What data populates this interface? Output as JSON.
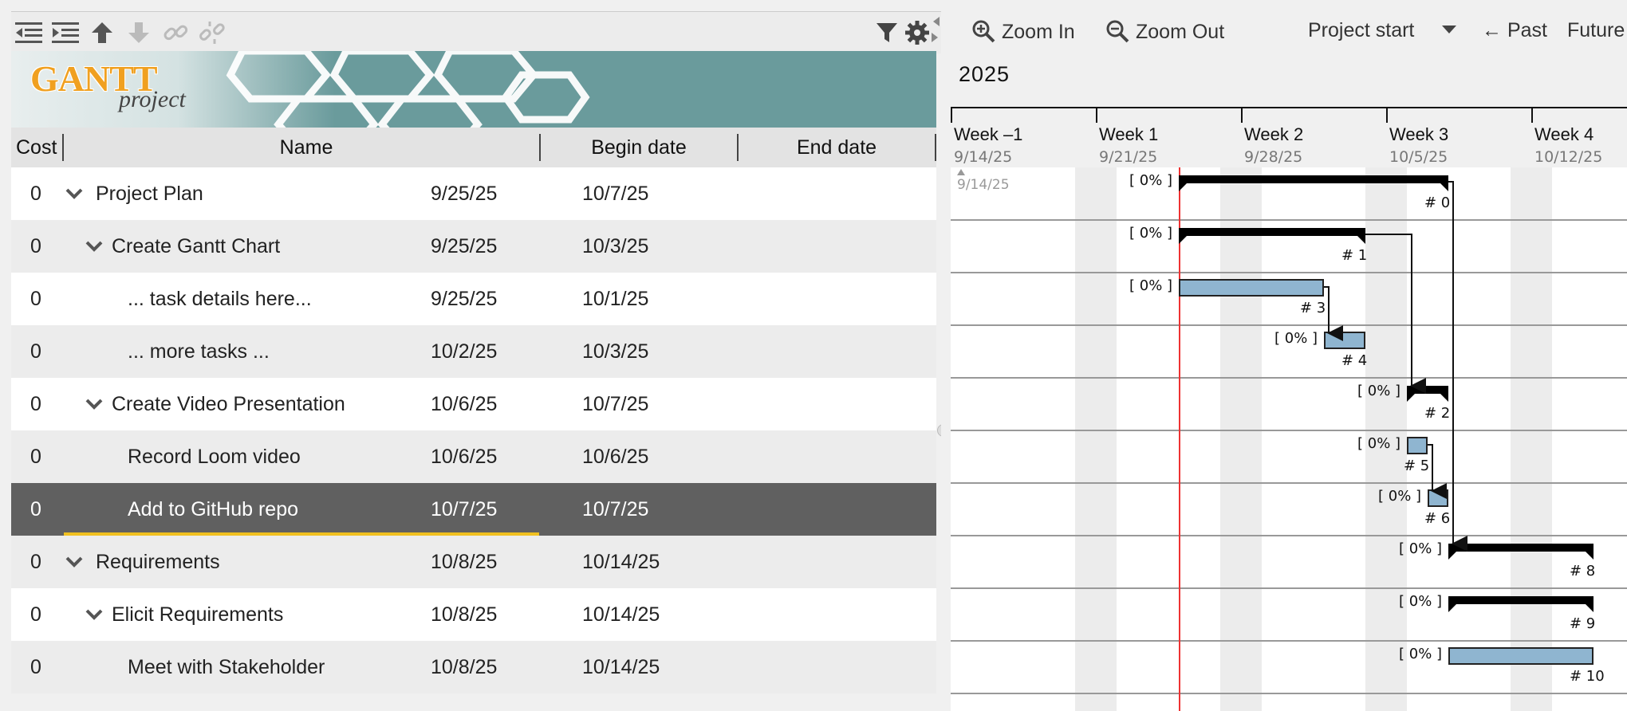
{
  "toolbar": {
    "icons": [
      "outdent-icon",
      "indent-icon",
      "move-up-icon",
      "move-down-icon",
      "link-icon",
      "unlink-icon",
      "filter-icon",
      "gear-icon"
    ]
  },
  "banner": {
    "logo_main": "GANTT",
    "logo_sub": "project"
  },
  "columns": {
    "cost": "Cost",
    "name": "Name",
    "begin": "Begin date",
    "end": "End date"
  },
  "tasks": [
    {
      "cost": "0",
      "name": "Project Plan",
      "begin": "9/25/25",
      "end": "10/7/25",
      "level": 0,
      "expandable": true
    },
    {
      "cost": "0",
      "name": "Create Gantt Chart",
      "begin": "9/25/25",
      "end": "10/3/25",
      "level": 1,
      "expandable": true
    },
    {
      "cost": "0",
      "name": "... task details here...",
      "begin": "9/25/25",
      "end": "10/1/25",
      "level": 2,
      "expandable": false
    },
    {
      "cost": "0",
      "name": "... more tasks ...",
      "begin": "10/2/25",
      "end": "10/3/25",
      "level": 2,
      "expandable": false
    },
    {
      "cost": "0",
      "name": "Create Video Presentation",
      "begin": "10/6/25",
      "end": "10/7/25",
      "level": 1,
      "expandable": true
    },
    {
      "cost": "0",
      "name": "Record Loom video",
      "begin": "10/6/25",
      "end": "10/6/25",
      "level": 2,
      "expandable": false
    },
    {
      "cost": "0",
      "name": "Add to GitHub repo",
      "begin": "10/7/25",
      "end": "10/7/25",
      "level": 2,
      "expandable": false,
      "selected": true
    },
    {
      "cost": "0",
      "name": "Requirements",
      "begin": "10/8/25",
      "end": "10/14/25",
      "level": 0,
      "expandable": true
    },
    {
      "cost": "0",
      "name": "Elicit Requirements",
      "begin": "10/8/25",
      "end": "10/14/25",
      "level": 1,
      "expandable": true
    },
    {
      "cost": "0",
      "name": "Meet with Stakeholder",
      "begin": "10/8/25",
      "end": "10/14/25",
      "level": 2,
      "expandable": false
    }
  ],
  "chart_toolbar": {
    "zoom_in": "Zoom In",
    "zoom_out": "Zoom Out",
    "project_start": "Project start",
    "past": "← Past",
    "future": "Future"
  },
  "chart": {
    "year": "2025",
    "weeks": [
      {
        "name": "Week –1",
        "date": "9/14/25"
      },
      {
        "name": "Week 1",
        "date": "9/21/25"
      },
      {
        "name": "Week 2",
        "date": "9/28/25"
      },
      {
        "name": "Week 3",
        "date": "10/5/25"
      },
      {
        "name": "Week 4",
        "date": "10/12/25"
      }
    ],
    "project_start_marker": "9/14/25",
    "today": "9/25/25",
    "bars": [
      {
        "id": "# 0",
        "progress": "[ 0% ]",
        "type": "summary"
      },
      {
        "id": "# 1",
        "progress": "[ 0% ]",
        "type": "summary"
      },
      {
        "id": "# 3",
        "progress": "[ 0% ]",
        "type": "task"
      },
      {
        "id": "# 4",
        "progress": "[ 0% ]",
        "type": "task"
      },
      {
        "id": "# 2",
        "progress": "[ 0% ]",
        "type": "summary"
      },
      {
        "id": "# 5",
        "progress": "[ 0% ]",
        "type": "task"
      },
      {
        "id": "# 6",
        "progress": "[ 0% ]",
        "type": "task"
      },
      {
        "id": "# 8",
        "progress": "[ 0% ]",
        "type": "summary"
      },
      {
        "id": "# 9",
        "progress": "[ 0% ]",
        "type": "summary"
      },
      {
        "id": "# 10",
        "progress": "[ 0% ]",
        "type": "task"
      }
    ]
  }
}
